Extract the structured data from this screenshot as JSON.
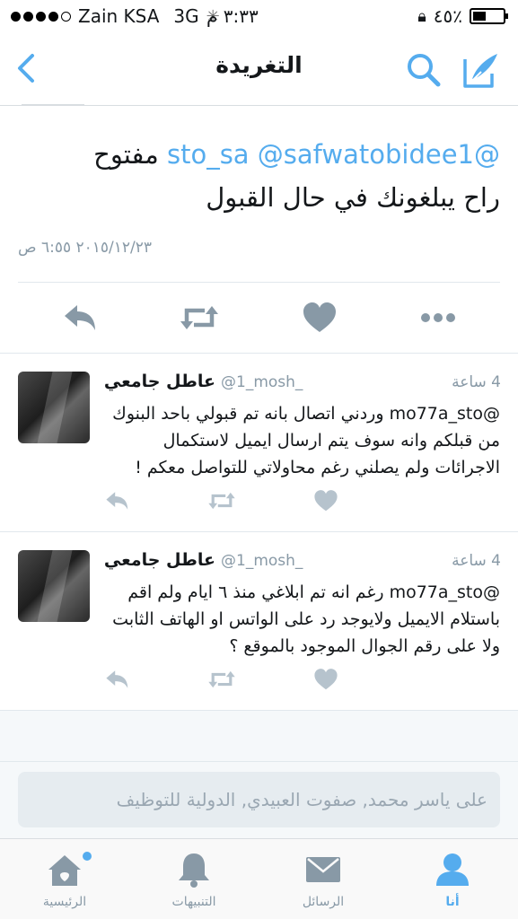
{
  "status_bar": {
    "carrier": "Zain KSA",
    "network": "3G",
    "time": "٣:٣٣ م",
    "battery": "٤٥٪"
  },
  "nav": {
    "title": "التغريدة"
  },
  "main_tweet": {
    "mention_1": "@sto_sa",
    "mention_2": "@safwatobidee1",
    "word_1": "مفتوح",
    "line_2": "راح يبلغونك في حال القبول",
    "date": "٢٠١٥/١٢/٢٣ ٦:٥٥ ص"
  },
  "replies": [
    {
      "name": "عاطل جامعي",
      "handle": "@1_mosh_",
      "time": "4 ساعة",
      "mention": "@mo77a_sto",
      "text": "وردني اتصال بانه تم قبولي باحد البنوك من قبلكم وانه سوف يتم ارسال ايميل لاستكمال الاجرائات ولم يصلني رغم محاولاتي للتواصل معكم !"
    },
    {
      "name": "عاطل جامعي",
      "handle": "@1_mosh_",
      "time": "4 ساعة",
      "mention": "@mo77a_sto",
      "text": "رغم انه تم ابلاغي منذ ٦ ايام ولم اقم باستلام الايميل ولايوجد رد على الواتس او الهاتف الثابت ولا على رقم الجوال الموجود بالموقع ؟"
    }
  ],
  "reply_box": {
    "placeholder": "على ياسر محمد, صفوت العبيدي, الدولية للتوظيف"
  },
  "tabs": [
    {
      "label": "الرئيسية",
      "icon": "home-icon"
    },
    {
      "label": "التنبيهات",
      "icon": "bell-icon"
    },
    {
      "label": "الرسائل",
      "icon": "envelope-icon"
    },
    {
      "label": "أنا",
      "icon": "person-icon"
    }
  ],
  "colors": {
    "accent": "#55acee",
    "icon_gray": "#8899a6",
    "light_icon": "#b6c3cd"
  }
}
